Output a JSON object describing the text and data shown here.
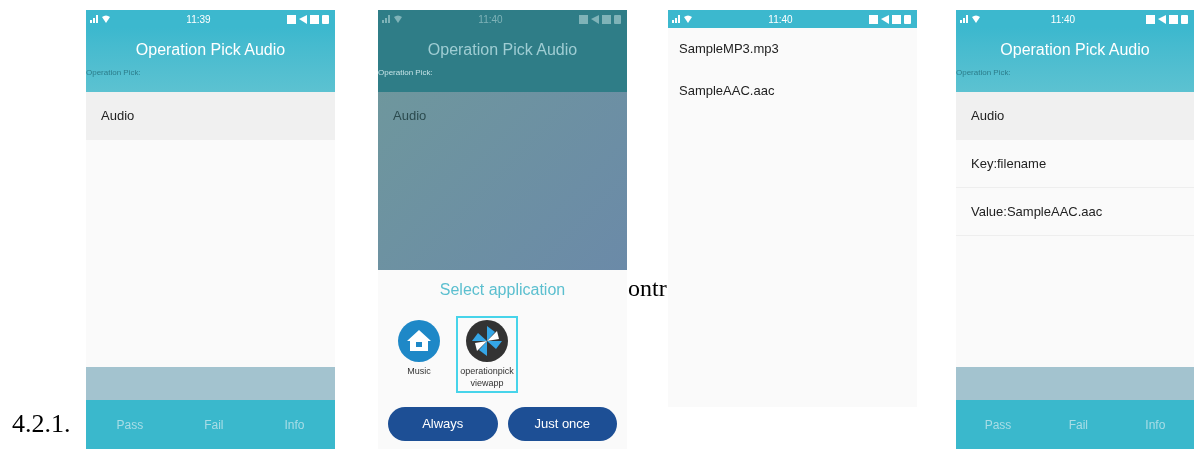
{
  "document": {
    "section_number": "4.2.1.",
    "fragment": "ontr"
  },
  "screens": [
    {
      "kind": "app",
      "status_time": "11:39",
      "title": "Operation Pick Audio",
      "subtitle": "Operation Pick:",
      "rows": [
        {
          "label": "Audio",
          "kind": "header"
        }
      ],
      "buttons": [
        "Pass",
        "Fail",
        "Info"
      ]
    },
    {
      "kind": "chooser",
      "status_time": "11:40",
      "title": "Operation Pick Audio",
      "subtitle": "Operation Pick:",
      "rows": [
        {
          "label": "Audio",
          "kind": "header"
        }
      ],
      "sheet": {
        "title": "Select application",
        "apps": [
          {
            "name": "Music",
            "kind": "home",
            "selected": false
          },
          {
            "name": "operationpickviewapp",
            "kind": "pinwheel",
            "selected": true
          }
        ],
        "buttons": [
          "Always",
          "Just once"
        ]
      }
    },
    {
      "kind": "files",
      "status_time": "11:40",
      "items": [
        "SampleMP3.mp3",
        "SampleAAC.aac"
      ]
    },
    {
      "kind": "app",
      "status_time": "11:40",
      "title": "Operation Pick Audio",
      "subtitle": "Operation Pick:",
      "rows": [
        {
          "label": "Audio",
          "kind": "header"
        },
        {
          "label": "Key:filename",
          "kind": "item"
        },
        {
          "label": "Value:SampleAAC.aac",
          "kind": "item"
        }
      ],
      "buttons": [
        "Pass",
        "Fail",
        "Info"
      ]
    }
  ]
}
